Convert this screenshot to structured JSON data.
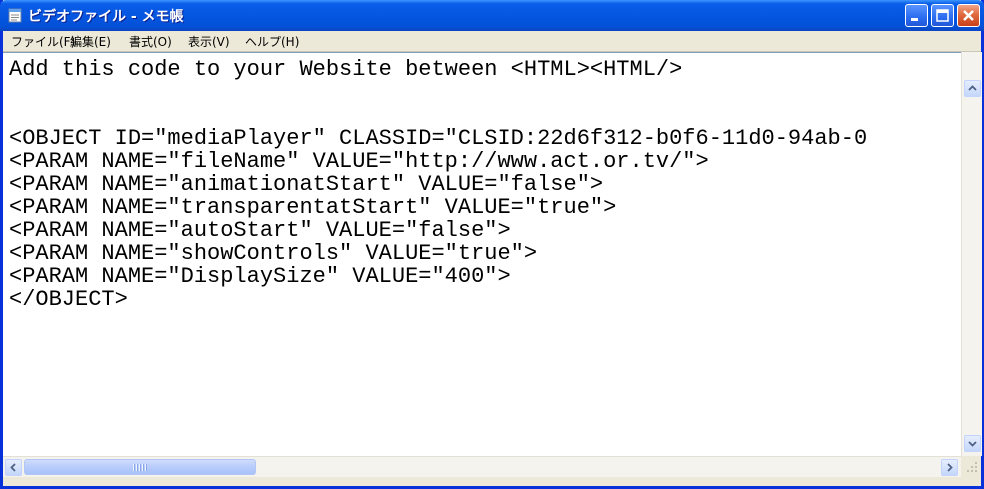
{
  "window": {
    "title": "ビデオファイル - メモ帳",
    "icon": "notepad-icon",
    "title_color": "#ffffff",
    "accent": "#0451d8"
  },
  "menu": {
    "items": [
      "ファイル(F)",
      "編集(E)",
      "書式(O)",
      "表示(V)",
      "ヘルプ(H)"
    ]
  },
  "editor": {
    "lines": [
      "Add this code to your Website between <HTML><HTML/>",
      "",
      "",
      "<OBJECT ID=\"mediaPlayer\" CLASSID=\"CLSID:22d6f312-b0f6-11d0-94ab-0",
      "<PARAM NAME=\"fileName\" VALUE=\"http://www.act.or.tv/\">",
      "<PARAM NAME=\"animationatStart\" VALUE=\"false\">",
      "<PARAM NAME=\"transparentatStart\" VALUE=\"true\">",
      "<PARAM NAME=\"autoStart\" VALUE=\"false\">",
      "<PARAM NAME=\"showControls\" VALUE=\"true\">",
      "<PARAM NAME=\"DisplaySize\" VALUE=\"400\">",
      "</OBJECT>"
    ]
  },
  "scrollbars": {
    "horizontal_position": 0,
    "vertical_position": 0
  }
}
